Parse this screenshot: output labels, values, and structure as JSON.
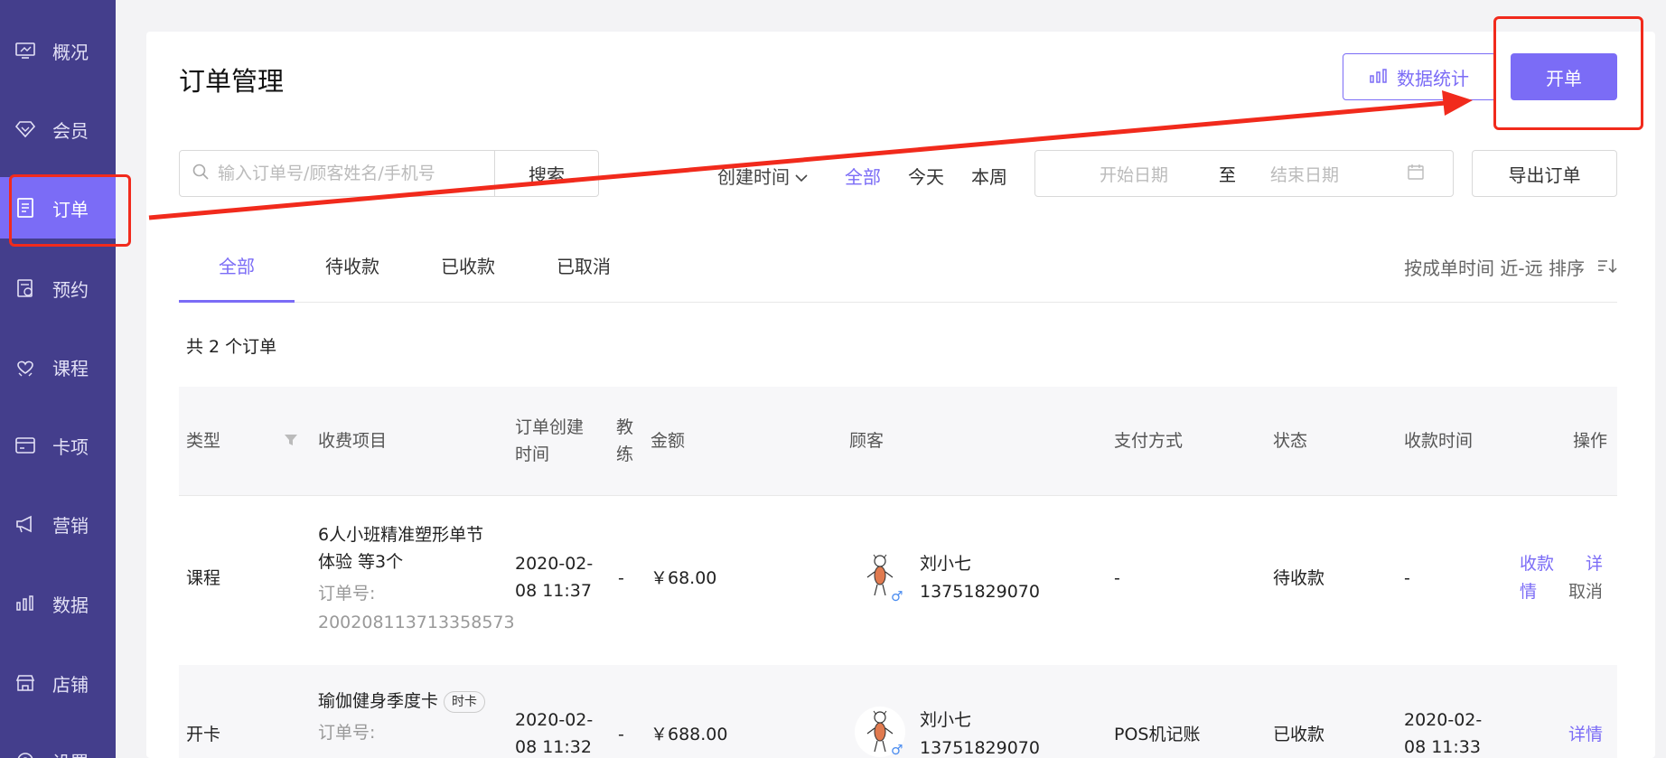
{
  "sidebar": {
    "items": [
      {
        "label": "概况",
        "icon": "monitor-icon"
      },
      {
        "label": "会员",
        "icon": "diamond-icon"
      },
      {
        "label": "订单",
        "icon": "order-list-icon",
        "active": true
      },
      {
        "label": "预约",
        "icon": "calendar-icon"
      },
      {
        "label": "课程",
        "icon": "heart-hands-icon"
      },
      {
        "label": "卡项",
        "icon": "card-icon"
      },
      {
        "label": "营销",
        "icon": "megaphone-icon"
      },
      {
        "label": "数据",
        "icon": "bar-chart-icon"
      },
      {
        "label": "店铺",
        "icon": "store-icon"
      },
      {
        "label": "设置",
        "icon": "settings-icon"
      }
    ]
  },
  "header": {
    "title": "订单管理",
    "stats_label": "数据统计",
    "open_label": "开单"
  },
  "filters": {
    "search_placeholder": "输入订单号/顾客姓名/手机号",
    "search_label": "搜索",
    "time_label": "创建时间",
    "quick": [
      "全部",
      "今天",
      "本周"
    ],
    "quick_active": "全部",
    "start_placeholder": "开始日期",
    "range_sep": "至",
    "end_placeholder": "结束日期",
    "export_label": "导出订单"
  },
  "tabs": [
    "全部",
    "待收款",
    "已收款",
    "已取消"
  ],
  "sort_label": "按成单时间 近-远 排序",
  "count_text": "共 2 个订单",
  "table": {
    "headers": {
      "type": "类型",
      "item": "收费项目",
      "created_1": "订单创建",
      "created_2": "时间",
      "coach_1": "教",
      "coach_2": "练",
      "amount": "金额",
      "customer": "顾客",
      "payment": "支付方式",
      "status": "状态",
      "paid_time": "收款时间",
      "actions": "操作"
    },
    "rows": [
      {
        "type": "课程",
        "item_1": "6人小班精准塑形单节",
        "item_2": "体验 等3个",
        "order_no_label": "订单号:",
        "order_no": "200208113713358573",
        "created_1": "2020-02-",
        "created_2": "08 11:37",
        "coach": "-",
        "amount": "￥68.00",
        "customer_name": "刘小七",
        "customer_phone": "13751829070",
        "payment": "-",
        "status": "待收款",
        "paid_time": "-",
        "action_1": "收款",
        "action_2a": "详",
        "action_2b": "情",
        "action_3": "取消"
      },
      {
        "type": "开卡",
        "item_1": "瑜伽健身季度卡",
        "item_tag": "时卡",
        "order_no_label": "订单号:",
        "created_1": "2020-02-",
        "created_2": "08 11:32",
        "coach": "-",
        "amount": "￥688.00",
        "customer_name": "刘小七",
        "customer_phone": "13751829070",
        "payment": "POS机记账",
        "status": "已收款",
        "paid_time_1": "2020-02-",
        "paid_time_2": "08 11:33",
        "action_1": "详情"
      }
    ]
  },
  "colors": {
    "sidebar_bg": "#443e8c",
    "accent": "#7b6cf6",
    "annotation_red": "#f12a1c"
  }
}
